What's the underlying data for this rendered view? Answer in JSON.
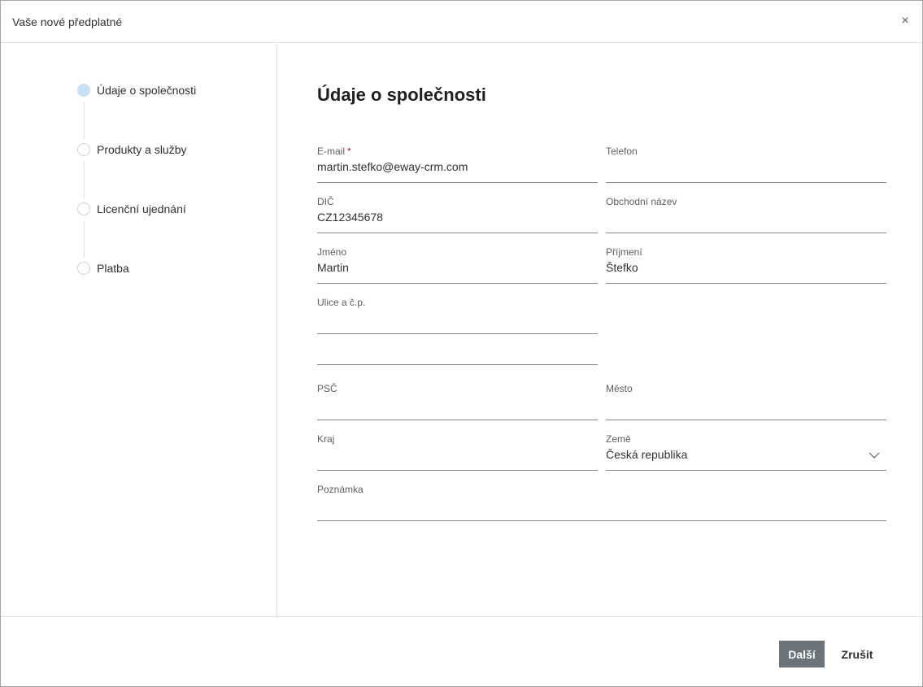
{
  "dialog": {
    "title": "Vaše nové předplatné",
    "close_glyph": "×",
    "close_icon": "close-icon"
  },
  "steps": [
    {
      "label": "Údaje o společnosti",
      "active": true
    },
    {
      "label": "Produkty a služby",
      "active": false
    },
    {
      "label": "Licenční ujednání",
      "active": false
    },
    {
      "label": "Platba",
      "active": false
    }
  ],
  "form": {
    "heading": "Údaje o společnosti",
    "email": {
      "label": "E-mail",
      "required_mark": "*",
      "value": "martin.stefko@eway-crm.com"
    },
    "phone": {
      "label": "Telefon",
      "value": ""
    },
    "dic": {
      "label": "DIČ",
      "value": "CZ12345678"
    },
    "trade_name": {
      "label": "Obchodní název",
      "value": ""
    },
    "first_name": {
      "label": "Jméno",
      "value": "Martin"
    },
    "last_name": {
      "label": "Příjmení",
      "value": "Štefko"
    },
    "street": {
      "label": "Ulice a č.p.",
      "value": ""
    },
    "street2": {
      "value": ""
    },
    "zip": {
      "label": "PSČ",
      "value": ""
    },
    "city": {
      "label": "Město",
      "value": ""
    },
    "region": {
      "label": "Kraj",
      "value": ""
    },
    "country": {
      "label": "Země",
      "value": "Česká republika"
    },
    "note": {
      "label": "Poznámka",
      "value": ""
    }
  },
  "footer": {
    "next_label": "Další",
    "cancel_label": "Zrušit"
  },
  "colors": {
    "active_step": "#c7e0f4",
    "primary_button": "#6b737b",
    "required": "#a4262c"
  }
}
